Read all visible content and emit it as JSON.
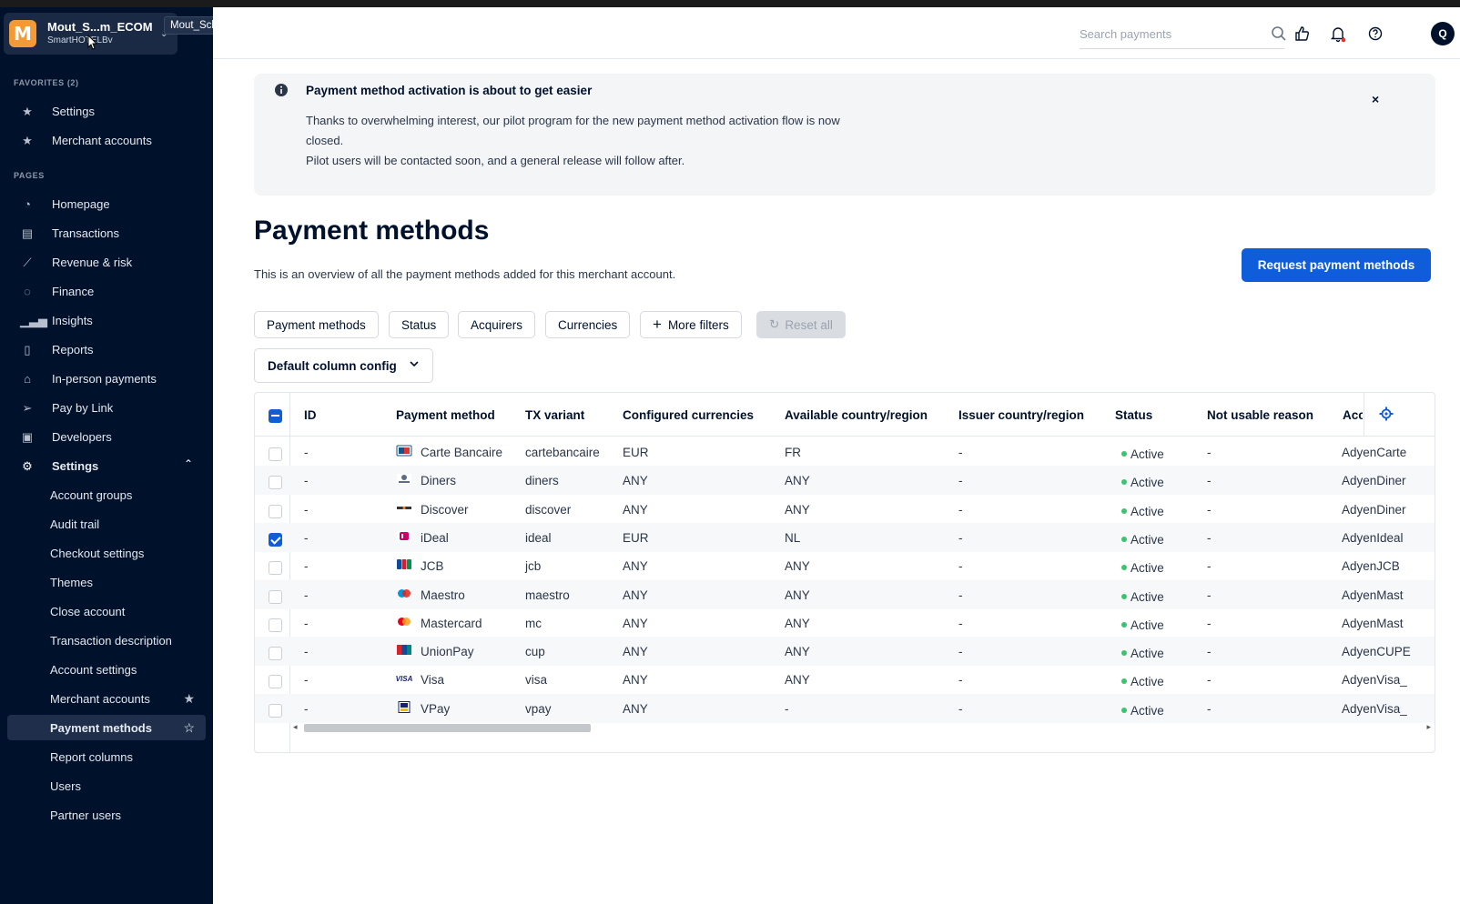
{
  "account": {
    "logo_letter": "M",
    "name": "Mout_S...m_ECOM",
    "company": "SmartHOTELBv",
    "tooltip": "Mout_Schiedam_ECOM"
  },
  "sidebar": {
    "favorites_title": "FAVORITES (2)",
    "favorites": [
      {
        "label": "Settings",
        "icon": "star-icon"
      },
      {
        "label": "Merchant accounts",
        "icon": "star-icon"
      }
    ],
    "pages_title": "PAGES",
    "pages": [
      {
        "label": "Homepage",
        "icon": "gauge-icon"
      },
      {
        "label": "Transactions",
        "icon": "table-icon"
      },
      {
        "label": "Revenue & risk",
        "icon": "chart-icon"
      },
      {
        "label": "Finance",
        "icon": "coins-icon"
      },
      {
        "label": "Insights",
        "icon": "bar-chart-icon"
      },
      {
        "label": "Reports",
        "icon": "document-icon"
      },
      {
        "label": "In-person payments",
        "icon": "store-icon"
      },
      {
        "label": "Pay by Link",
        "icon": "paper-plane-icon"
      },
      {
        "label": "Developers",
        "icon": "terminal-icon"
      },
      {
        "label": "Settings",
        "icon": "gear-icon"
      }
    ],
    "settings_sub": [
      "Account groups",
      "Audit trail",
      "Checkout settings",
      "Themes",
      "Close account",
      "Transaction description",
      "Account settings",
      "Merchant accounts",
      "Payment methods",
      "Report columns",
      "Users",
      "Partner users"
    ]
  },
  "topbar": {
    "search_placeholder": "Search payments",
    "avatar_initial": "Q"
  },
  "banner": {
    "title": "Payment method activation is about to get easier",
    "lines": [
      "Thanks to overwhelming interest, our pilot program for the new payment method activation flow is now",
      "closed.",
      "Pilot users will be contacted soon, and a general release will follow after."
    ],
    "close": "×"
  },
  "page": {
    "title": "Payment methods",
    "description": "This is an overview of all the payment methods added for this merchant account.",
    "request_button": "Request payment methods"
  },
  "filters": {
    "payment_methods": "Payment methods",
    "status": "Status",
    "acquirers": "Acquirers",
    "currencies": "Currencies",
    "more_filters": "More filters",
    "reset_all": "Reset all",
    "column_config": "Default column config"
  },
  "table": {
    "columns": [
      "ID",
      "Payment method",
      "TX variant",
      "Configured currencies",
      "Available country/region",
      "Issuer country/region",
      "Status",
      "Not usable reason",
      "Acc"
    ],
    "rows": [
      {
        "id": "-",
        "method": "Carte Bancaire",
        "tx": "cartebancaire",
        "currencies": "EUR",
        "country": "FR",
        "issuer": "-",
        "status": "Active",
        "reason": "-",
        "acc": "AdyenCarte",
        "checked": false
      },
      {
        "id": "-",
        "method": "Diners",
        "tx": "diners",
        "currencies": "ANY",
        "country": "ANY",
        "issuer": "-",
        "status": "Active",
        "reason": "-",
        "acc": "AdyenDiner",
        "checked": false
      },
      {
        "id": "-",
        "method": "Discover",
        "tx": "discover",
        "currencies": "ANY",
        "country": "ANY",
        "issuer": "-",
        "status": "Active",
        "reason": "-",
        "acc": "AdyenDiner",
        "checked": false
      },
      {
        "id": "-",
        "method": "iDeal",
        "tx": "ideal",
        "currencies": "EUR",
        "country": "NL",
        "issuer": "-",
        "status": "Active",
        "reason": "-",
        "acc": "AdyenIdeal",
        "checked": true
      },
      {
        "id": "-",
        "method": "JCB",
        "tx": "jcb",
        "currencies": "ANY",
        "country": "ANY",
        "issuer": "-",
        "status": "Active",
        "reason": "-",
        "acc": "AdyenJCB",
        "checked": false
      },
      {
        "id": "-",
        "method": "Maestro",
        "tx": "maestro",
        "currencies": "ANY",
        "country": "ANY",
        "issuer": "-",
        "status": "Active",
        "reason": "-",
        "acc": "AdyenMast",
        "checked": false
      },
      {
        "id": "-",
        "method": "Mastercard",
        "tx": "mc",
        "currencies": "ANY",
        "country": "ANY",
        "issuer": "-",
        "status": "Active",
        "reason": "-",
        "acc": "AdyenMast",
        "checked": false
      },
      {
        "id": "-",
        "method": "UnionPay",
        "tx": "cup",
        "currencies": "ANY",
        "country": "ANY",
        "issuer": "-",
        "status": "Active",
        "reason": "-",
        "acc": "AdyenCUPE",
        "checked": false
      },
      {
        "id": "-",
        "method": "Visa",
        "tx": "visa",
        "currencies": "ANY",
        "country": "ANY",
        "issuer": "-",
        "status": "Active",
        "reason": "-",
        "acc": "AdyenVisa_",
        "checked": false
      },
      {
        "id": "-",
        "method": "VPay",
        "tx": "vpay",
        "currencies": "ANY",
        "country": "-",
        "issuer": "-",
        "status": "Active",
        "reason": "-",
        "acc": "AdyenVisa_",
        "checked": false
      }
    ]
  },
  "colors": {
    "sidebar_bg": "#00112c",
    "accent": "#0f5dda",
    "active_status": "#3ac470",
    "logo": "#f29a38"
  }
}
